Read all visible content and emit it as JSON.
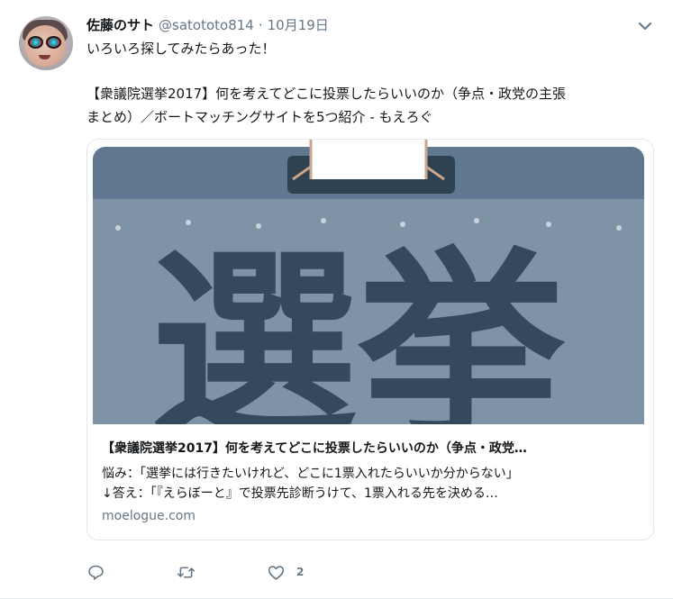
{
  "tweet": {
    "name": "佐藤のサト",
    "handle": "@satototo814",
    "separator": "·",
    "time": "10月19日",
    "text_line1": "いろいろ探してみたらあった！",
    "text_line3": "【衆議院選挙2017】何を考えてどこに投票したらいいのか（争点・政党の主張",
    "text_line4": "まとめ）／ボートマッチングサイトを5つ紹介 - もえろぐ"
  },
  "card": {
    "image_text": "選挙",
    "title": "【衆議院選挙2017】何を考えてどこに投票したらいいのか（争点・政党…",
    "desc_line1": "悩み：「選挙には行きたいけれど、どこに1票入れたらいいか分からない」",
    "desc_line2": "↓答え：「『えらぼーと』で投票先診断うけて、1票入れる先を決める…",
    "domain": "moelogue.com"
  },
  "actions": {
    "reply_icon": "reply-icon",
    "retweet_icon": "retweet-icon",
    "like_icon": "heart-icon",
    "like_count": "2"
  },
  "colors": {
    "text": "#14171a",
    "secondary": "#657786",
    "border": "#e1e8ed",
    "sign_bg": "#5f7890",
    "sign_ink": "#344a5c"
  }
}
